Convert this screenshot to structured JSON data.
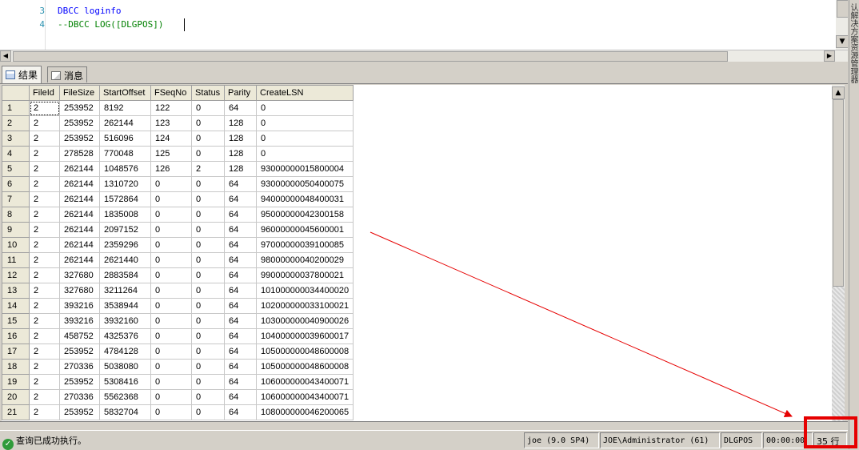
{
  "editor": {
    "lines": [
      {
        "num": "3",
        "text": "DBCC loginfo"
      },
      {
        "num": "4",
        "text": "--DBCC LOG([DLGPOS])"
      }
    ]
  },
  "side_panel": {
    "label": "认解决方案资源管理器"
  },
  "tabs": [
    {
      "label": "结果",
      "icon": "grid-icon",
      "active": true
    },
    {
      "label": "消息",
      "icon": "message-icon",
      "active": false
    }
  ],
  "grid": {
    "columns": [
      "FileId",
      "FileSize",
      "StartOffset",
      "FSeqNo",
      "Status",
      "Parity",
      "CreateLSN"
    ],
    "rows": [
      [
        "1",
        "2",
        "253952",
        "8192",
        "122",
        "0",
        "64",
        "0"
      ],
      [
        "2",
        "2",
        "253952",
        "262144",
        "123",
        "0",
        "128",
        "0"
      ],
      [
        "3",
        "2",
        "253952",
        "516096",
        "124",
        "0",
        "128",
        "0"
      ],
      [
        "4",
        "2",
        "278528",
        "770048",
        "125",
        "0",
        "128",
        "0"
      ],
      [
        "5",
        "2",
        "262144",
        "1048576",
        "126",
        "2",
        "128",
        "93000000015800004"
      ],
      [
        "6",
        "2",
        "262144",
        "1310720",
        "0",
        "0",
        "64",
        "93000000050400075"
      ],
      [
        "7",
        "2",
        "262144",
        "1572864",
        "0",
        "0",
        "64",
        "94000000048400031"
      ],
      [
        "8",
        "2",
        "262144",
        "1835008",
        "0",
        "0",
        "64",
        "95000000042300158"
      ],
      [
        "9",
        "2",
        "262144",
        "2097152",
        "0",
        "0",
        "64",
        "96000000045600001"
      ],
      [
        "10",
        "2",
        "262144",
        "2359296",
        "0",
        "0",
        "64",
        "97000000039100085"
      ],
      [
        "11",
        "2",
        "262144",
        "2621440",
        "0",
        "0",
        "64",
        "98000000040200029"
      ],
      [
        "12",
        "2",
        "327680",
        "2883584",
        "0",
        "0",
        "64",
        "99000000037800021"
      ],
      [
        "13",
        "2",
        "327680",
        "3211264",
        "0",
        "0",
        "64",
        "101000000034400020"
      ],
      [
        "14",
        "2",
        "393216",
        "3538944",
        "0",
        "0",
        "64",
        "102000000033100021"
      ],
      [
        "15",
        "2",
        "393216",
        "3932160",
        "0",
        "0",
        "64",
        "103000000040900026"
      ],
      [
        "16",
        "2",
        "458752",
        "4325376",
        "0",
        "0",
        "64",
        "104000000039600017"
      ],
      [
        "17",
        "2",
        "253952",
        "4784128",
        "0",
        "0",
        "64",
        "105000000048600008"
      ],
      [
        "18",
        "2",
        "270336",
        "5038080",
        "0",
        "0",
        "64",
        "105000000048600008"
      ],
      [
        "19",
        "2",
        "253952",
        "5308416",
        "0",
        "0",
        "64",
        "106000000043400071"
      ],
      [
        "20",
        "2",
        "270336",
        "5562368",
        "0",
        "0",
        "64",
        "106000000043400071"
      ],
      [
        "21",
        "2",
        "253952",
        "5832704",
        "0",
        "0",
        "64",
        "108000000046200065"
      ]
    ]
  },
  "status": {
    "message": "查询已成功执行。",
    "server": "joe (9.0 SP4)",
    "user": "JOE\\Administrator (61)",
    "database": "DLGPOS",
    "elapsed": "00:00:00",
    "rows": "35 行"
  },
  "colors": {
    "annotation": "#e60000",
    "success": "#2f9b3a",
    "keyword": "#0000ff",
    "comment": "#008000"
  }
}
